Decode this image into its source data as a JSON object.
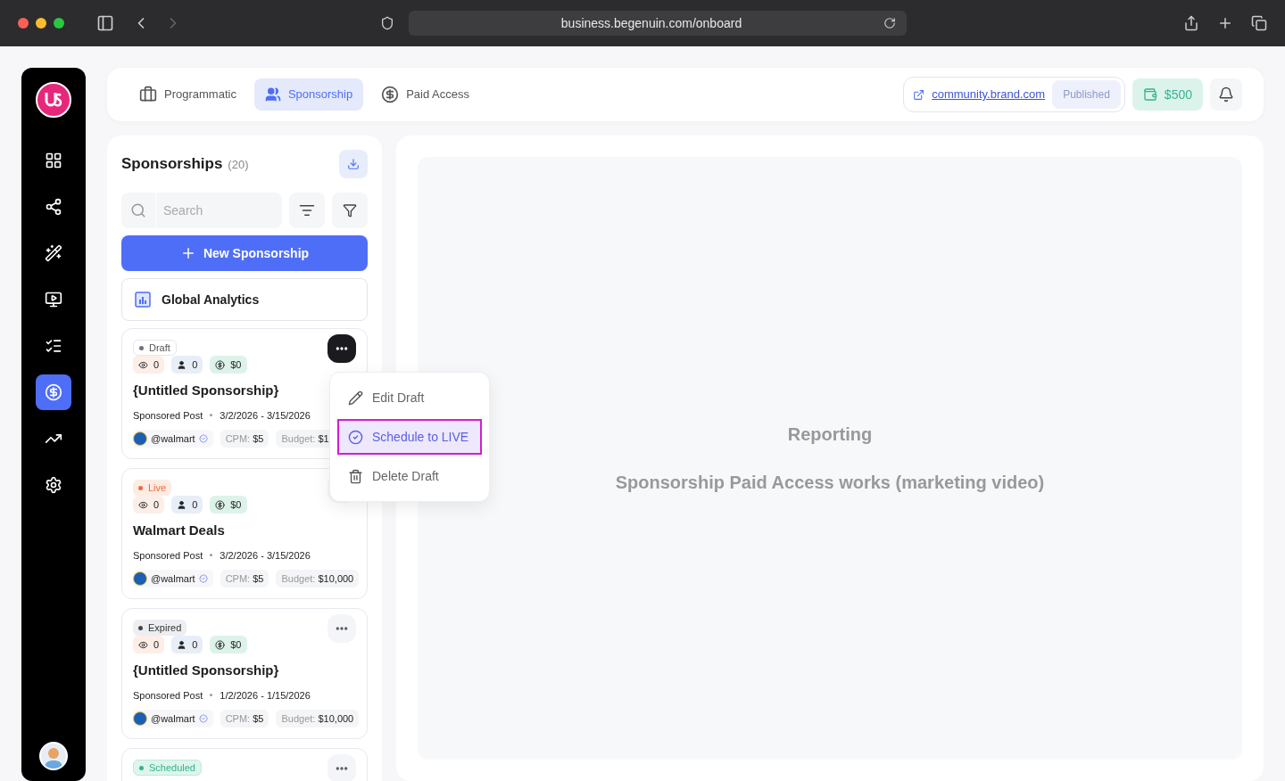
{
  "browser": {
    "url": "business.begenuin.com/onboard"
  },
  "sidebar": {
    "items": [
      {
        "selected": false
      },
      {
        "selected": false
      },
      {
        "selected": false
      },
      {
        "selected": false
      },
      {
        "selected": false
      },
      {
        "selected": true
      },
      {
        "selected": false
      },
      {
        "selected": false
      }
    ]
  },
  "tabs": [
    {
      "label": "Programmatic",
      "selected": false
    },
    {
      "label": "Sponsorship",
      "selected": true
    },
    {
      "label": "Paid Access",
      "selected": false
    }
  ],
  "header": {
    "link": "community.brand.com",
    "publish_label": "Published",
    "publish_disabled": true,
    "balance": "$500"
  },
  "panel": {
    "title": "Sponsorships",
    "count": "(20)",
    "search_placeholder": "Search",
    "new_button": "New Sponsorship",
    "analytics": "Global Analytics"
  },
  "cards": [
    {
      "kind": "draft",
      "status": "Draft",
      "views": "0",
      "members": "0",
      "earnings": "$0",
      "title": "{Untitled Sponsorship}",
      "type": "Sponsored Post",
      "dates": "3/2/2026 - 3/15/2026",
      "handle": "@walmart",
      "cpm": "CPM: **$5**",
      "budget": "Budget: **$1**",
      "menu_open": true
    },
    {
      "kind": "live",
      "status": "Live",
      "views": "0",
      "members": "0",
      "earnings": "$0",
      "title": "Walmart Deals",
      "type": "Sponsored Post",
      "dates": "3/2/2026 - 3/15/2026",
      "handle": "@walmart",
      "cpm": "CPM: **$5**",
      "budget": "Budget: **$10,000**",
      "menu_open": false
    },
    {
      "kind": "expired",
      "status": "Expired",
      "views": "0",
      "members": "0",
      "earnings": "$0",
      "title": "{Untitled Sponsorship}",
      "type": "Sponsored Post",
      "dates": "1/2/2026 - 1/15/2026",
      "handle": "@walmart",
      "cpm": "CPM: **$5**",
      "budget": "Budget: **$10,000**",
      "menu_open": false
    },
    {
      "kind": "scheduled",
      "status": "Scheduled",
      "menu_open": false
    }
  ],
  "menu": {
    "items": [
      {
        "label": "Edit Draft",
        "selected": false
      },
      {
        "label": "Schedule to LIVE",
        "selected": true
      },
      {
        "label": "Delete Draft",
        "selected": false
      }
    ]
  },
  "reporting": {
    "title": "Reporting",
    "subtitle": "Sponsorship Paid Access works (marketing video)"
  }
}
